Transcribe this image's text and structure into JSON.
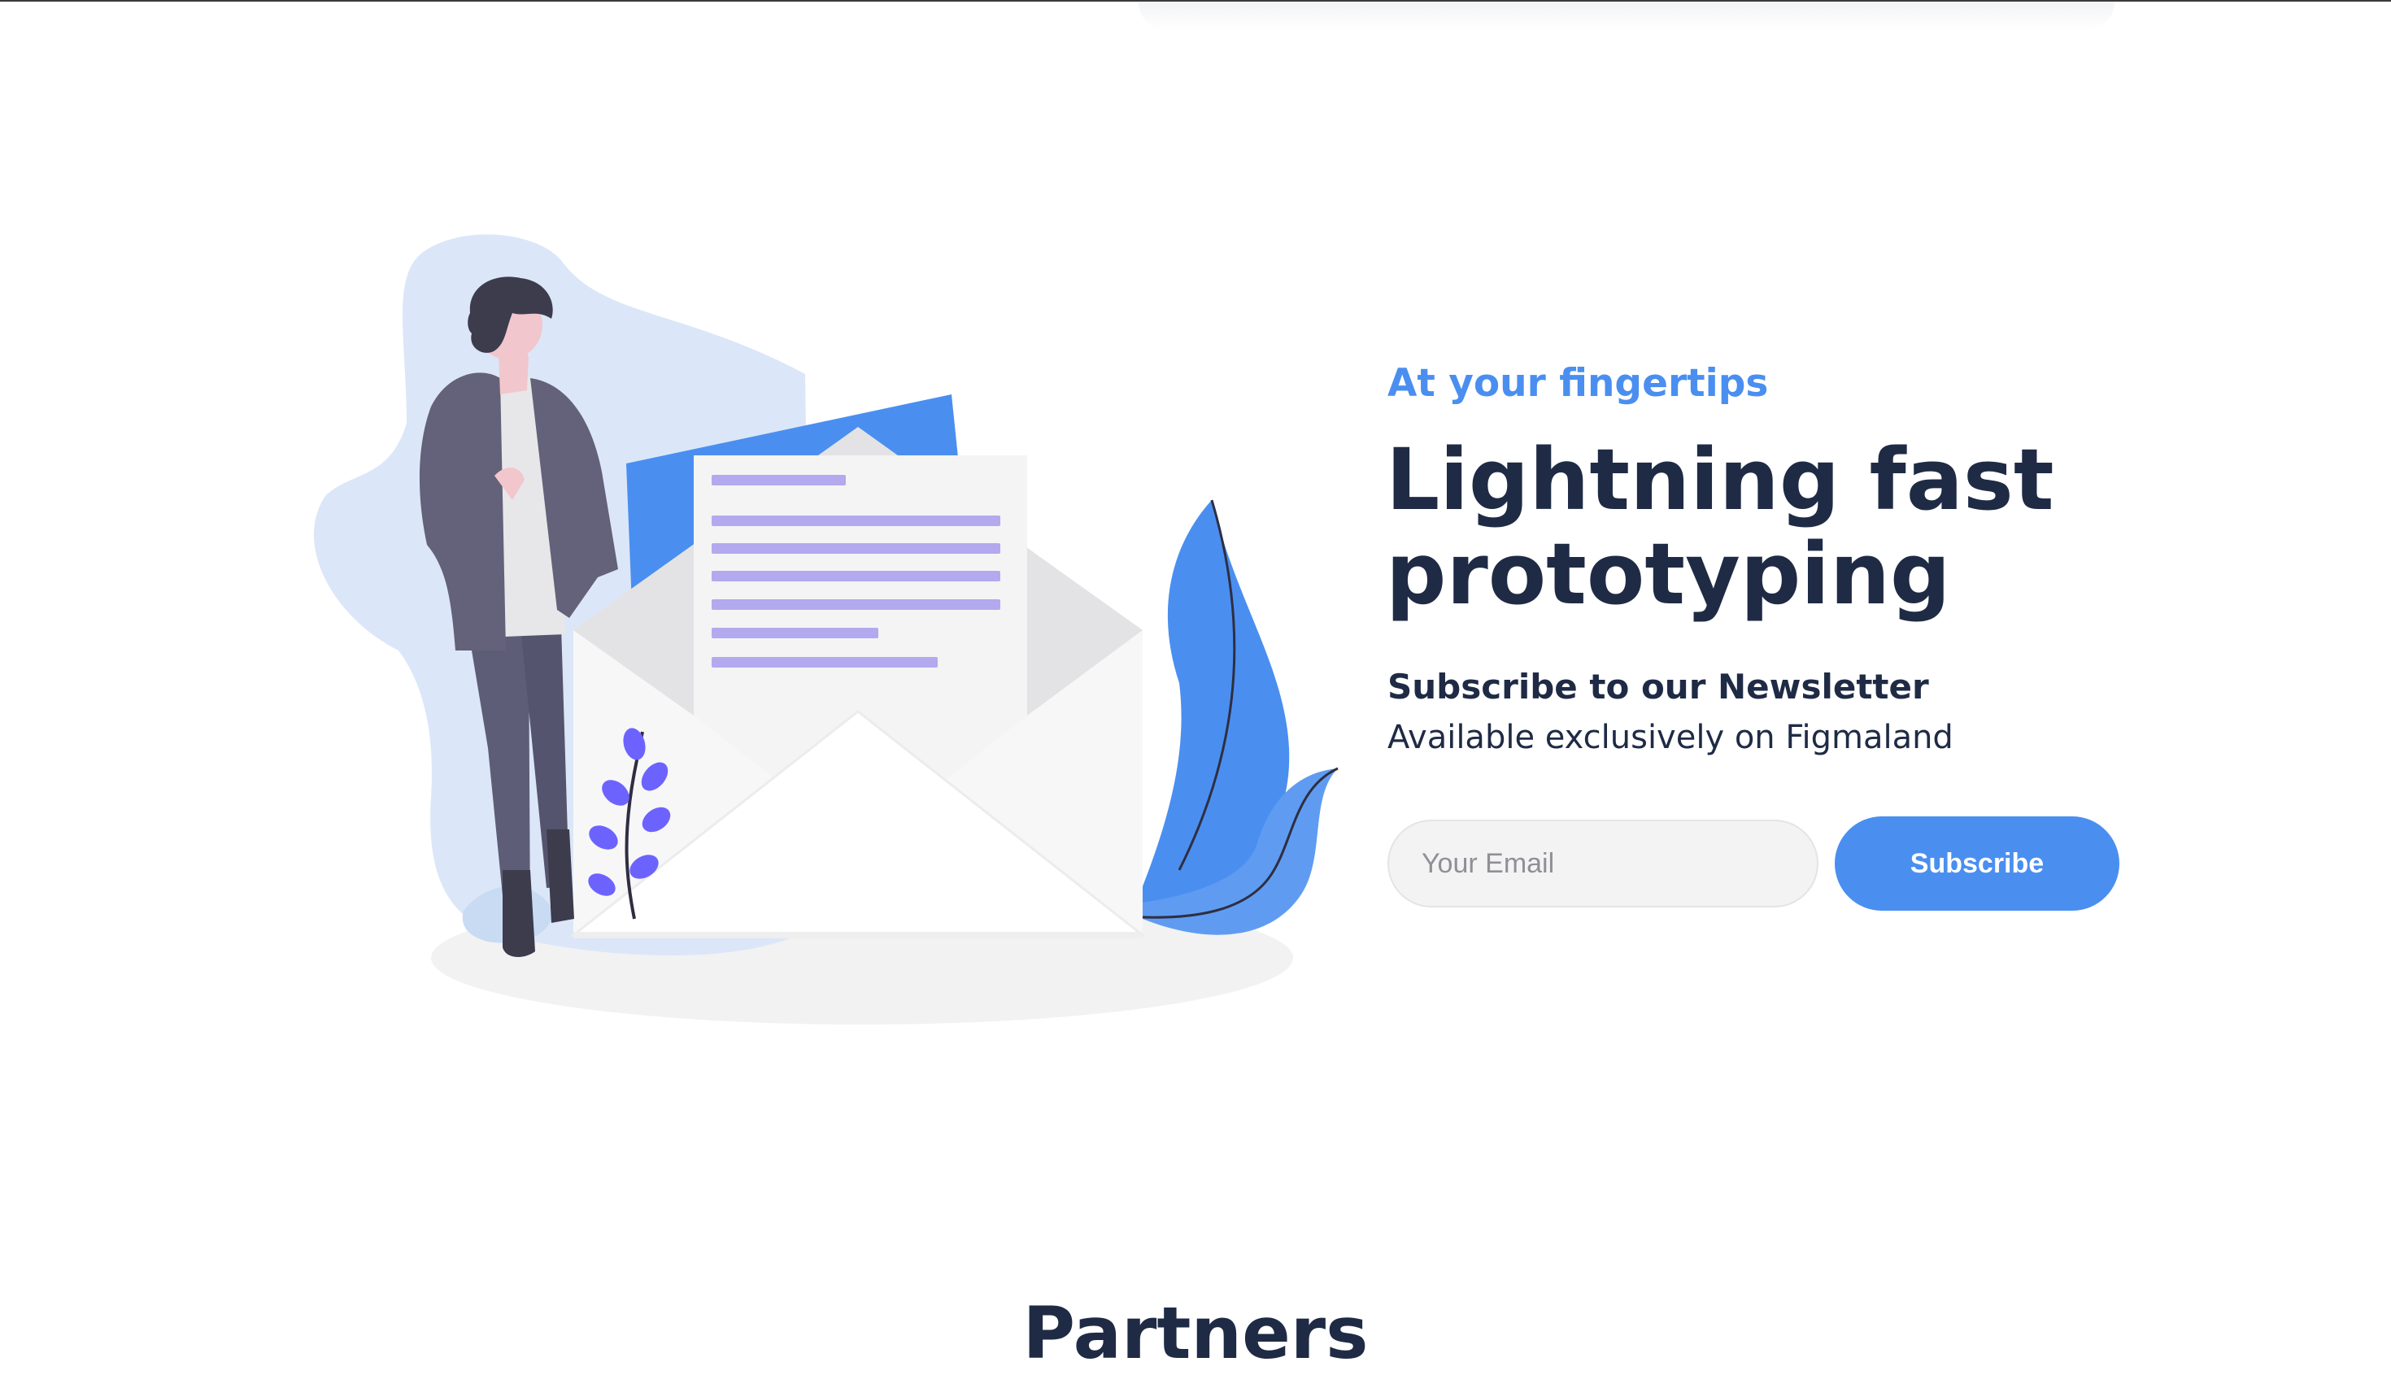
{
  "hero": {
    "eyebrow": "At your fingertips",
    "headline": "Lightning fast prototyping",
    "illustration_icon": "person-with-open-envelope-illustration"
  },
  "newsletter": {
    "title": "Subscribe to our Newsletter",
    "subtitle": "Available exclusively on Figmaland",
    "email_value": "",
    "email_placeholder": "Your Email",
    "button_label": "Subscribe"
  },
  "partners": {
    "heading": "Partners"
  },
  "colors": {
    "accent": "#4a8ff0",
    "heading": "#1f2b45",
    "input_background": "#f3f3f4",
    "illustration_blob": "#dbe7f8",
    "illustration_lines": "#b3a9ee",
    "leaf_purple": "#6c63ff",
    "person_jacket": "#63627a"
  }
}
